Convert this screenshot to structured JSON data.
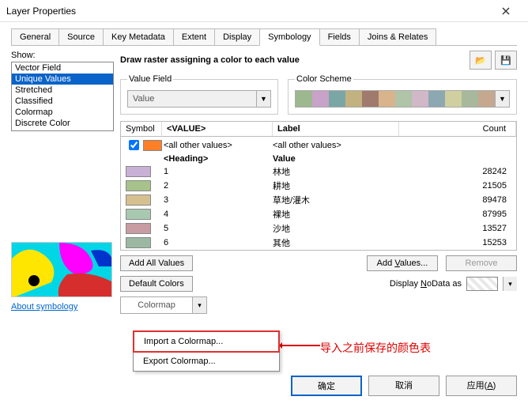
{
  "window": {
    "title": "Layer Properties"
  },
  "tabs": [
    "General",
    "Source",
    "Key Metadata",
    "Extent",
    "Display",
    "Symbology",
    "Fields",
    "Joins & Relates"
  ],
  "active_tab": "Symbology",
  "show": {
    "label": "Show:",
    "items": [
      "Vector Field",
      "Unique Values",
      "Stretched",
      "Classified",
      "Colormap",
      "Discrete Color"
    ],
    "selected": "Unique Values"
  },
  "about_link": "About symbology",
  "header": {
    "title": "Draw raster assigning a color to each value"
  },
  "value_field": {
    "legend": "Value Field",
    "value": "Value"
  },
  "color_scheme": {
    "legend": "Color Scheme",
    "colors": [
      "#9db88f",
      "#c8a2c8",
      "#7ba6a6",
      "#c2b280",
      "#a07a6c",
      "#d9b38c",
      "#b0c4a8",
      "#d0b8c8",
      "#8ca8b0",
      "#cfcfa0",
      "#a8b89c",
      "#c4a890"
    ]
  },
  "table": {
    "headers": {
      "symbol": "Symbol",
      "value": "<VALUE>",
      "label": "Label",
      "count": "Count"
    },
    "allrow": {
      "value": "<all other values>",
      "label": "<all other values>",
      "color": "#ff7f27"
    },
    "heading": {
      "value": "<Heading>",
      "label": "Value"
    },
    "rows": [
      {
        "v": "1",
        "l": "林地",
        "c": 28242,
        "col": "#c9b0d6"
      },
      {
        "v": "2",
        "l": "耕地",
        "c": 21505,
        "col": "#a7c28b"
      },
      {
        "v": "3",
        "l": "草地/灌木",
        "c": 89478,
        "col": "#d6c090"
      },
      {
        "v": "4",
        "l": "裸地",
        "c": 87995,
        "col": "#a9c8b0"
      },
      {
        "v": "5",
        "l": "沙地",
        "c": 13527,
        "col": "#c89ca2"
      },
      {
        "v": "6",
        "l": "其他",
        "c": 15253,
        "col": "#9cb8a2"
      }
    ]
  },
  "buttons": {
    "add_all": "Add All Values",
    "add_values": "Add Values...",
    "remove": "Remove",
    "default_colors": "Default Colors",
    "colormap": "Colormap",
    "nodata_label": "Display NoData as",
    "ok": "确定",
    "cancel": "取消",
    "apply": "应用(A)"
  },
  "menu": {
    "import": "Import a Colormap...",
    "export": "Export Colormap..."
  },
  "annotation": "导入之前保存的颜色表"
}
